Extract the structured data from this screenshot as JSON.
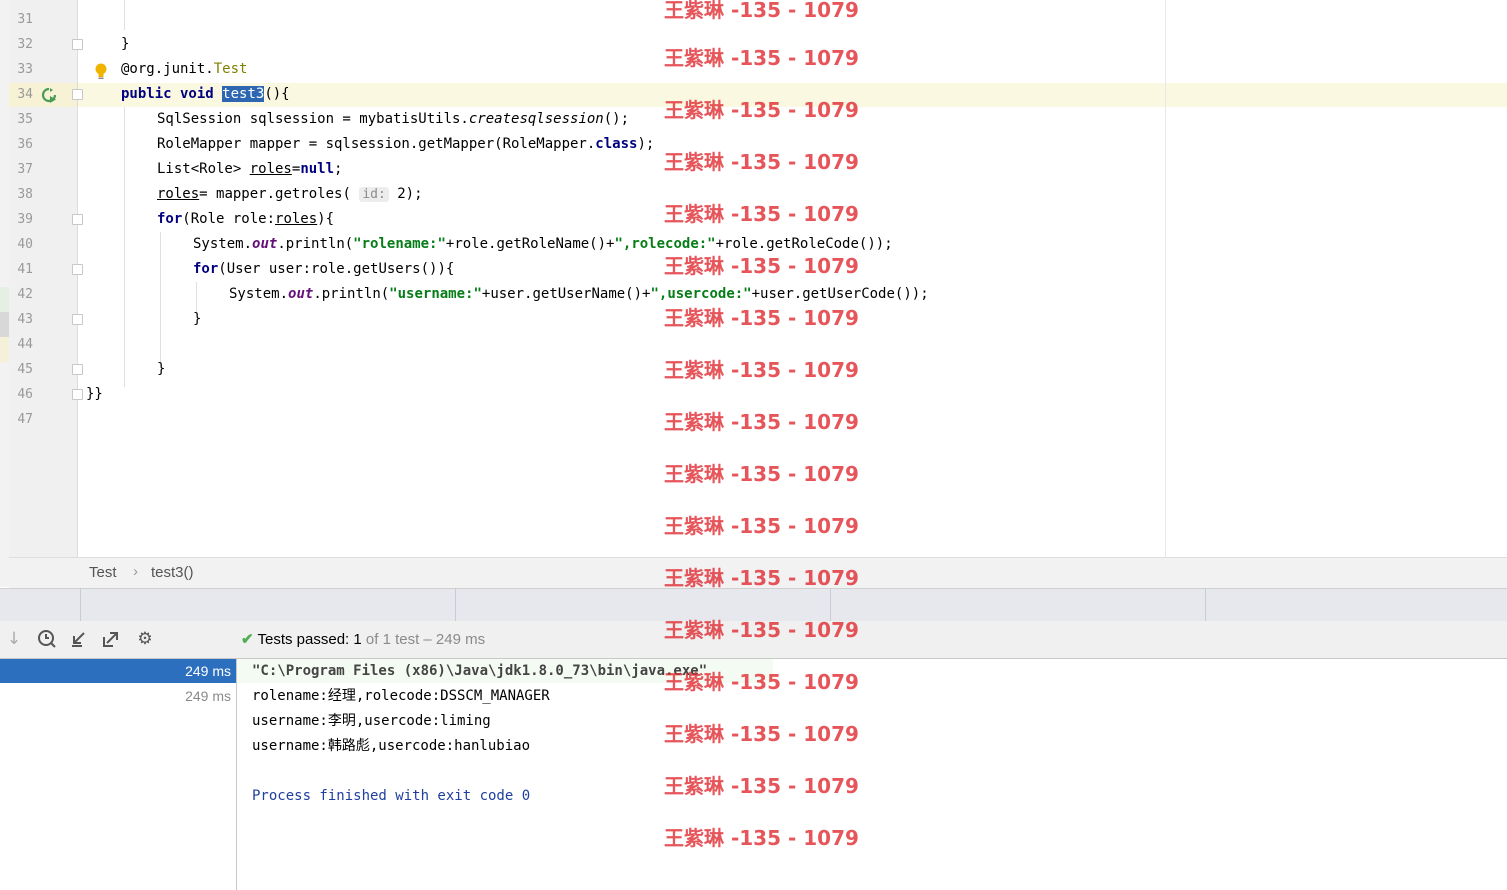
{
  "editor": {
    "lines": [
      {
        "num": "31"
      },
      {
        "num": "32"
      },
      {
        "num": "33"
      },
      {
        "num": "34"
      },
      {
        "num": "35"
      },
      {
        "num": "36"
      },
      {
        "num": "37"
      },
      {
        "num": "38"
      },
      {
        "num": "39"
      },
      {
        "num": "40"
      },
      {
        "num": "41"
      },
      {
        "num": "42"
      },
      {
        "num": "43"
      },
      {
        "num": "44"
      },
      {
        "num": "45"
      },
      {
        "num": "46"
      },
      {
        "num": "47"
      }
    ],
    "code": {
      "l32": "}",
      "l33_at": "@org.junit.",
      "l33_ann": "Test",
      "l34_kw": "public void ",
      "l34_name": "test3",
      "l34_rest": "(){",
      "l35_a": "SqlSession sqlsession = mybatisUtils.",
      "l35_b": "createsqlsession",
      "l35_c": "();",
      "l36_a": "RoleMapper mapper = sqlsession.getMapper(RoleMapper.",
      "l36_kw": "class",
      "l36_c": ");",
      "l37_a": "List<Role> ",
      "l37_b": "roles",
      "l37_c": "=",
      "l37_kw": "null",
      "l37_d": ";",
      "l38_a": "roles",
      "l38_b": "= mapper.getroles(",
      "l38_hint": "id:",
      "l38_c": " 2);",
      "l39_kw": "for",
      "l39_a": "(Role role:",
      "l39_b": "roles",
      "l39_c": "){",
      "l40_a": "System.",
      "l40_fld": "out",
      "l40_b": ".println(",
      "l40_s1": "\"rolename:\"",
      "l40_c": "+role.getRoleName()+",
      "l40_s2": "\",rolecode:\"",
      "l40_d": "+role.getRoleCode());",
      "l41_kw": "for",
      "l41_a": "(User user:role.getUsers()){",
      "l42_a": "System.",
      "l42_fld": "out",
      "l42_b": ".println(",
      "l42_s1": "\"username:\"",
      "l42_c": "+user.getUserName()+",
      "l42_s2": "\",usercode:\"",
      "l42_d": "+user.getUserCode());",
      "l43": "}",
      "l45": "}",
      "l46": "}}"
    }
  },
  "breadcrumb": {
    "class": "Test",
    "separator": "›",
    "method": "test3()"
  },
  "run": {
    "status_icon": "check-icon",
    "status_prefix": "Tests passed:",
    "status_count": " 1",
    "status_suffix": " of 1 test – 249 ms",
    "tree": [
      {
        "time": "249 ms",
        "selected": true
      },
      {
        "time": "249 ms",
        "selected": false
      }
    ],
    "console": [
      "\"C:\\Program Files (x86)\\Java\\jdk1.8.0_73\\bin\\java.exe\"",
      "rolename:经理,rolecode:DSSCM_MANAGER",
      "username:李明,usercode:liming",
      "username:韩路彪,usercode:hanlubiao",
      "",
      "Process finished with exit code 0"
    ]
  },
  "watermark": {
    "text": "王紫琳 -135 - 1079",
    "color": "#e0262d"
  },
  "colors": {
    "keyword": "#000080",
    "string": "#067d17",
    "annotation": "#808000",
    "selection": "#2d67b2",
    "tree_selected": "#2d6fbf"
  }
}
